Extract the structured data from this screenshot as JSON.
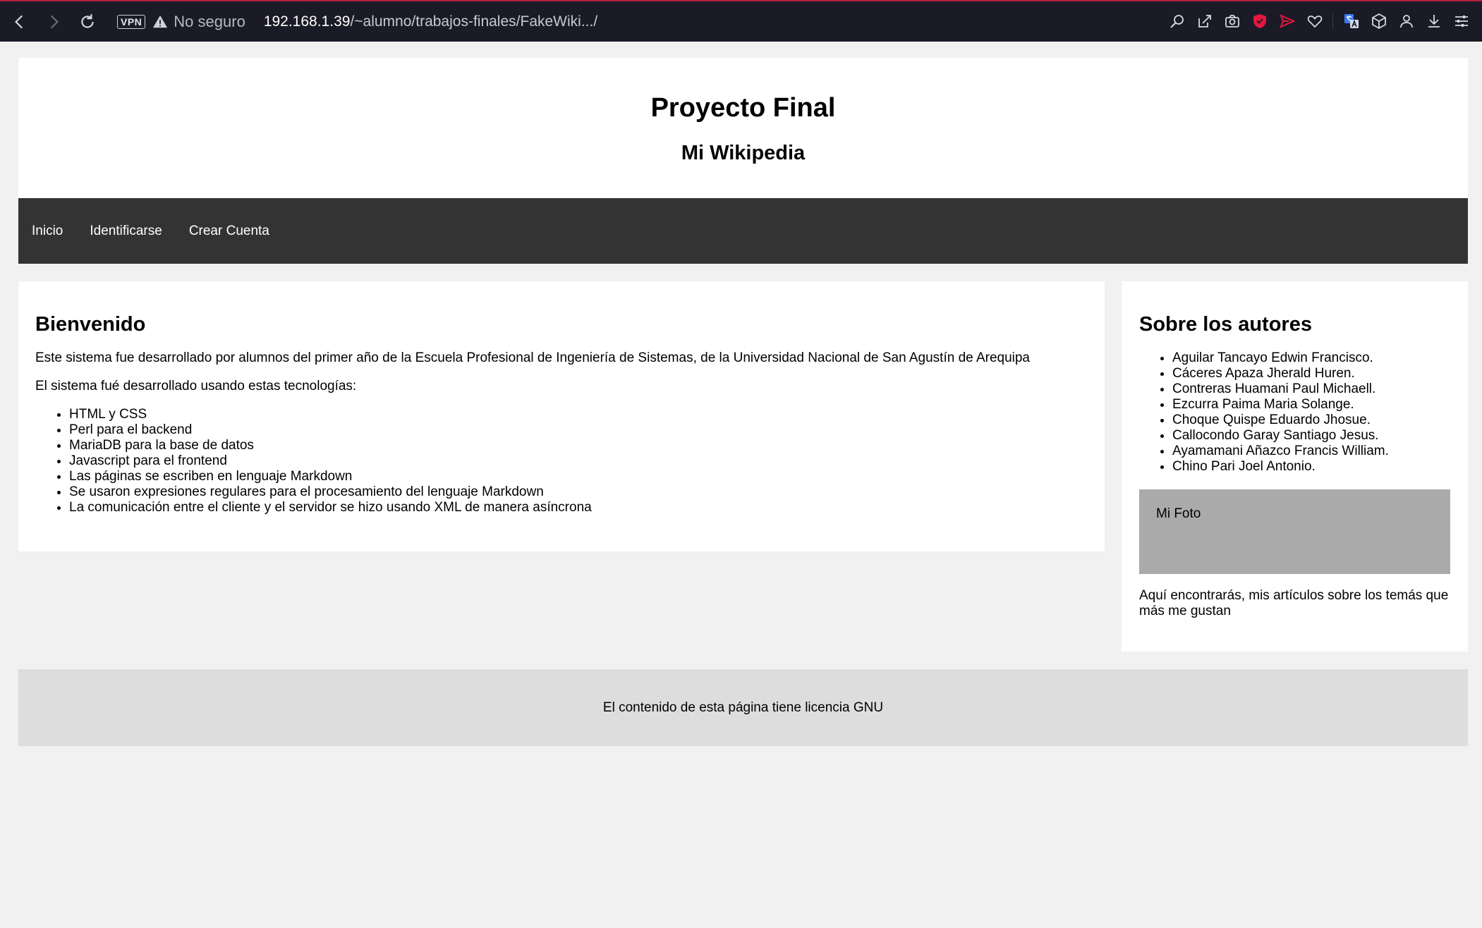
{
  "browser": {
    "vpn_label": "VPN",
    "security_text": "No seguro",
    "url_host": "192.168.1.39",
    "url_path": "/~alumno/trabajos-finales/FakeWiki.../",
    "accent_color": "#b3203a"
  },
  "header": {
    "title": "Proyecto Final",
    "subtitle": "Mi Wikipedia"
  },
  "nav": {
    "items": [
      {
        "label": "Inicio"
      },
      {
        "label": "Identificarse"
      },
      {
        "label": "Crear Cuenta"
      }
    ]
  },
  "main": {
    "heading": "Bienvenido",
    "intro": "Este sistema fue desarrollado por alumnos del primer año de la Escuela Profesional de Ingeniería de Sistemas, de la Universidad Nacional de San Agustín de Arequipa",
    "tech_intro": "El sistema fué desarrollado usando estas tecnologías:",
    "tech_list": [
      "HTML y CSS",
      "Perl para el backend",
      "MariaDB para la base de datos",
      "Javascript para el frontend",
      "Las páginas se escriben en lenguaje Markdown",
      "Se usaron expresiones regulares para el procesamiento del lenguaje Markdown",
      "La comunicación entre el cliente y el servidor se hizo usando XML de manera asíncrona"
    ]
  },
  "sidebar": {
    "heading": "Sobre los autores",
    "authors": [
      "Aguilar Tancayo Edwin Francisco.",
      "Cáceres Apaza Jherald Huren.",
      "Contreras Huamani Paul Michaell.",
      "Ezcurra Paima Maria Solange.",
      "Choque Quispe Eduardo Jhosue.",
      "Callocondo Garay Santiago Jesus.",
      "Ayamamani Añazco Francis William.",
      "Chino Pari Joel Antonio."
    ],
    "photo_label": "Mi Foto",
    "text": "Aquí encontrarás, mis artículos sobre los temás que más me gustan"
  },
  "footer": {
    "text": "El contenido de esta página tiene licencia GNU"
  },
  "icons": {
    "toolbar_right": [
      "search-zoom-icon",
      "edit-share-icon",
      "camera-icon",
      "shield-icon",
      "send-icon",
      "heart-icon",
      "translate-icon",
      "cube-icon",
      "profile-icon",
      "download-icon",
      "menu-settings-icon"
    ]
  }
}
